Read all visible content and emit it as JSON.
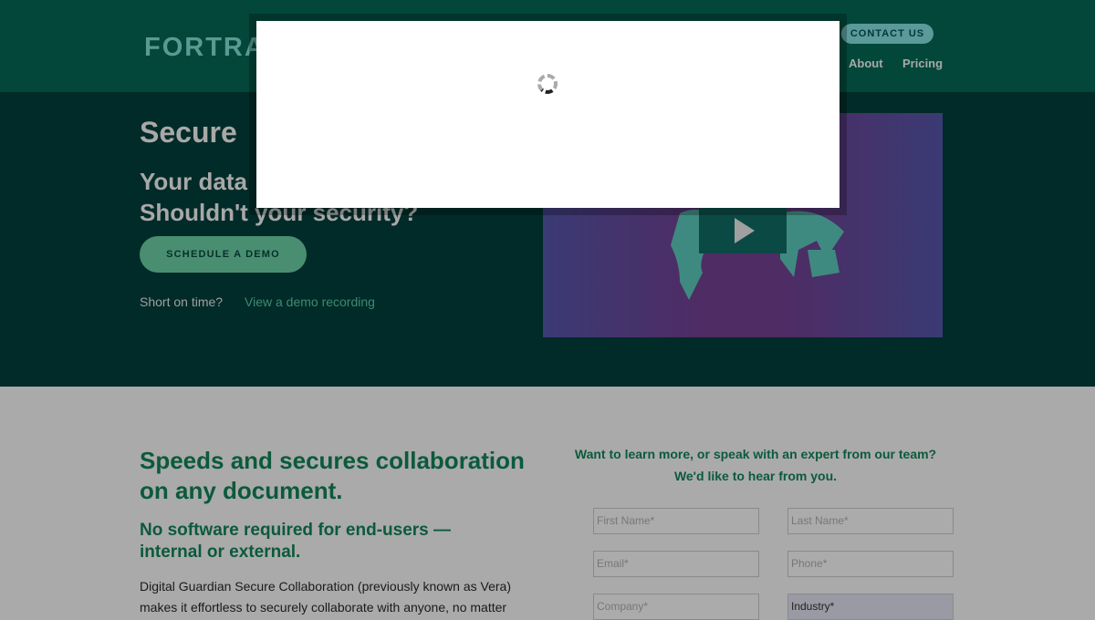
{
  "header": {
    "logo": "FORTRA",
    "contact": "CONTACT US",
    "nav": [
      "About",
      "Pricing"
    ]
  },
  "hero": {
    "title": "Secure",
    "subtitle_l1": "Your data",
    "subtitle_l2": "Shouldn't your security?",
    "demo_button": "SCHEDULE A DEMO",
    "short": "Short on time?",
    "recording_link": "View a demo recording"
  },
  "lower": {
    "heading": "Speeds and secures collaboration on any document.",
    "subheading": "No software required for end-users — internal or external.",
    "body": "Digital Guardian Secure Collaboration (previously known as Vera) makes it effortless to securely collaborate with anyone, no matter",
    "form_title_l1": "Want to learn more, or speak with an expert from our team?",
    "form_title_l2": "We'd like to hear from you.",
    "fields": [
      "First Name*",
      "Last Name*",
      "Email*",
      "Phone*",
      "Company*",
      "Industry*"
    ]
  }
}
